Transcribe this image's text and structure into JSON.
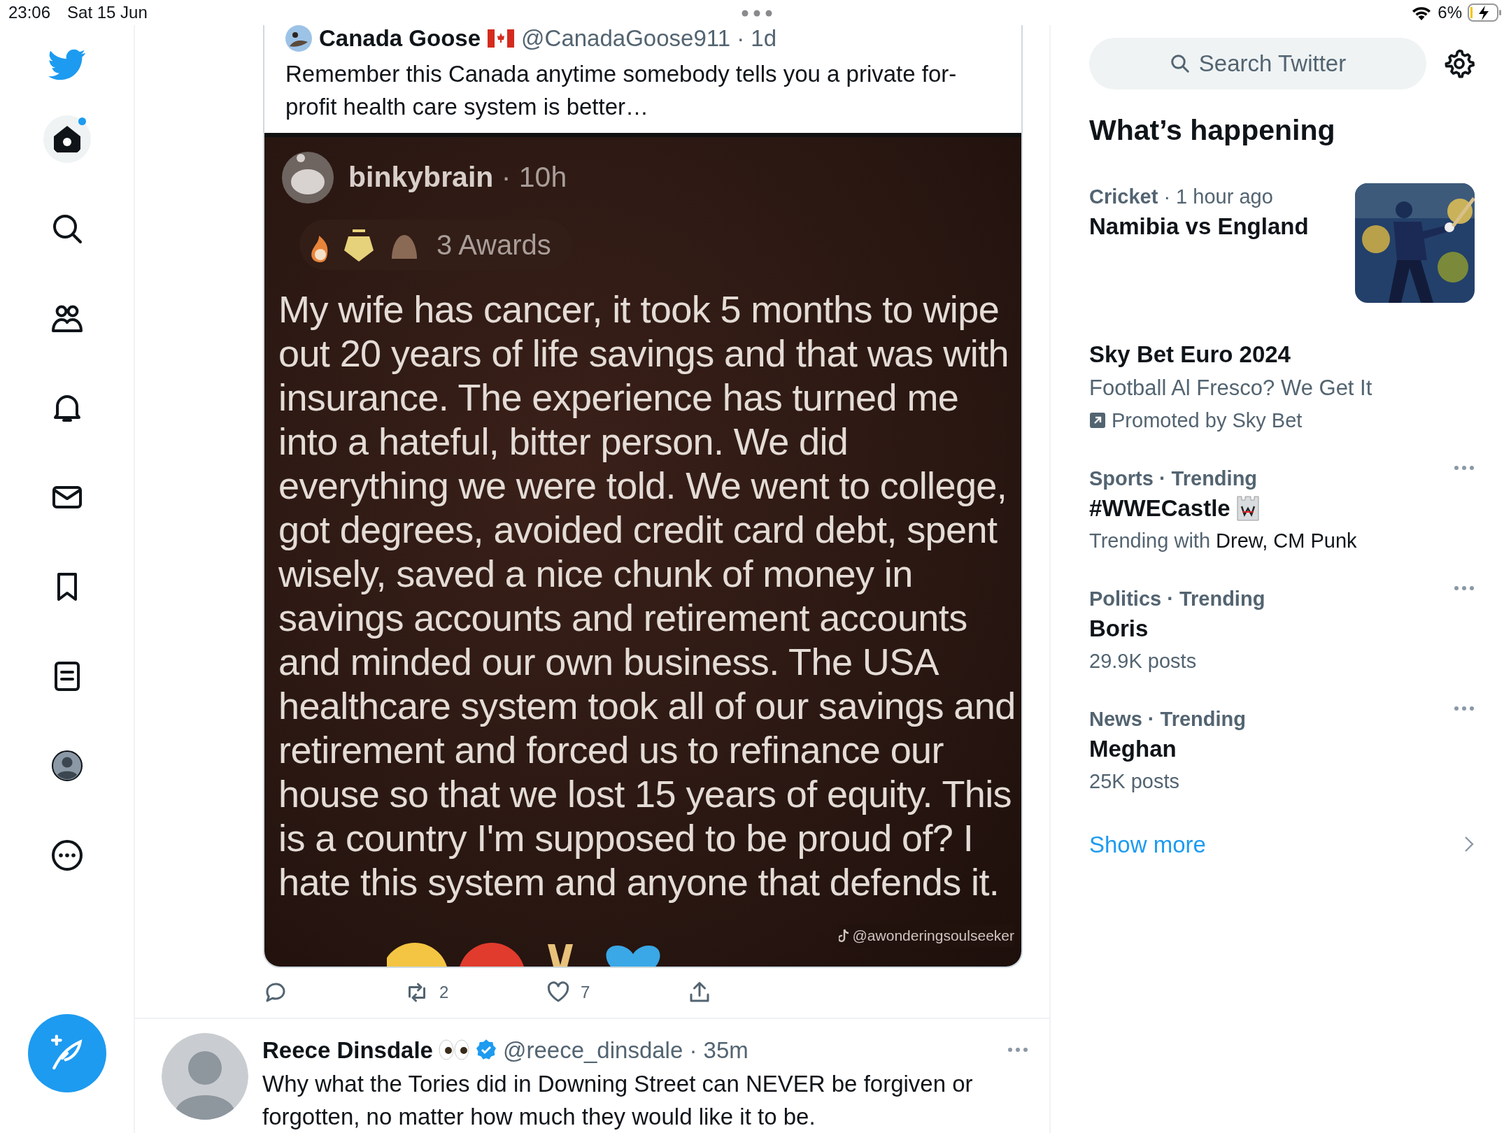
{
  "status_bar": {
    "time": "23:06",
    "date": "Sat 15 Jun",
    "battery_text": "6%"
  },
  "nav": [
    {
      "kind": "home",
      "selected": true,
      "unread": true
    },
    {
      "kind": "explore",
      "selected": false,
      "unread": false
    },
    {
      "kind": "communities",
      "selected": false,
      "unread": false
    },
    {
      "kind": "notifications",
      "selected": false,
      "unread": false
    },
    {
      "kind": "messages",
      "selected": false,
      "unread": false
    },
    {
      "kind": "bookmarks",
      "selected": false,
      "unread": false
    },
    {
      "kind": "lists",
      "selected": false,
      "unread": false
    },
    {
      "kind": "profile",
      "selected": false,
      "unread": false
    },
    {
      "kind": "more",
      "selected": false,
      "unread": false
    }
  ],
  "quoted_tweet": {
    "name": "Canada Goose",
    "meta": "@CanadaGoose911 · 1d",
    "text": "Remember this Canada anytime somebody tells you a private for-profit health care system is better…",
    "embed": {
      "username": "binkybrain",
      "age": "· 10h",
      "awards": "3 Awards",
      "body": "My wife has cancer, it took 5 months to wipe out 20 years of life savings and that was with insurance. The experience has turned me into a hateful, bitter person. We did everything we were told. We went to college, got degrees, avoided credit card debt, spent wisely, saved a nice chunk of money in savings accounts and retirement accounts and minded our own business. The USA healthcare system took all of our savings and retirement and forced us to refinance our house so that we lost 15 years of equity. This is a country I'm supposed to be proud of? I hate this system and anyone that defends it.",
      "credit": "@awonderingsoulseeker"
    }
  },
  "actions": [
    {
      "kind": "reply"
    },
    {
      "kind": "retweet",
      "count": "2"
    },
    {
      "kind": "like",
      "count": "7"
    },
    {
      "kind": "share"
    }
  ],
  "tweets": [
    {
      "name": "Reece Dinsdale",
      "verified": true,
      "meta": "@reece_dinsdale · 35m",
      "text": "Why what the Tories did in Downing Street can NEVER be forgiven or forgotten, no matter how much they would like it to be."
    }
  ],
  "search": {
    "placeholder": "Search Twitter"
  },
  "whats_happening": {
    "title": "What’s happening",
    "items": [
      {
        "kind": "news",
        "meta": "**Cricket** · 1 hour ago",
        "title": "Namibia vs England"
      },
      {
        "kind": "promoted",
        "title": "Sky Bet Euro 2024",
        "subtitle": "Football Al Fresco? We Get It",
        "promoted": "Promoted by Sky Bet"
      },
      {
        "kind": "trend",
        "category": "Sports · Trending",
        "title": "#WWECastle",
        "emoji": true,
        "context_label": "Trending with",
        "context_names": "Drew, CM Punk"
      },
      {
        "kind": "trend",
        "category": "Politics · Trending",
        "title": "Boris",
        "emoji": false,
        "posts": "29.9K posts"
      },
      {
        "kind": "trend",
        "category": "News · Trending",
        "title": "Meghan",
        "emoji": false,
        "posts": "25K posts"
      }
    ],
    "show_more": "Show more"
  }
}
